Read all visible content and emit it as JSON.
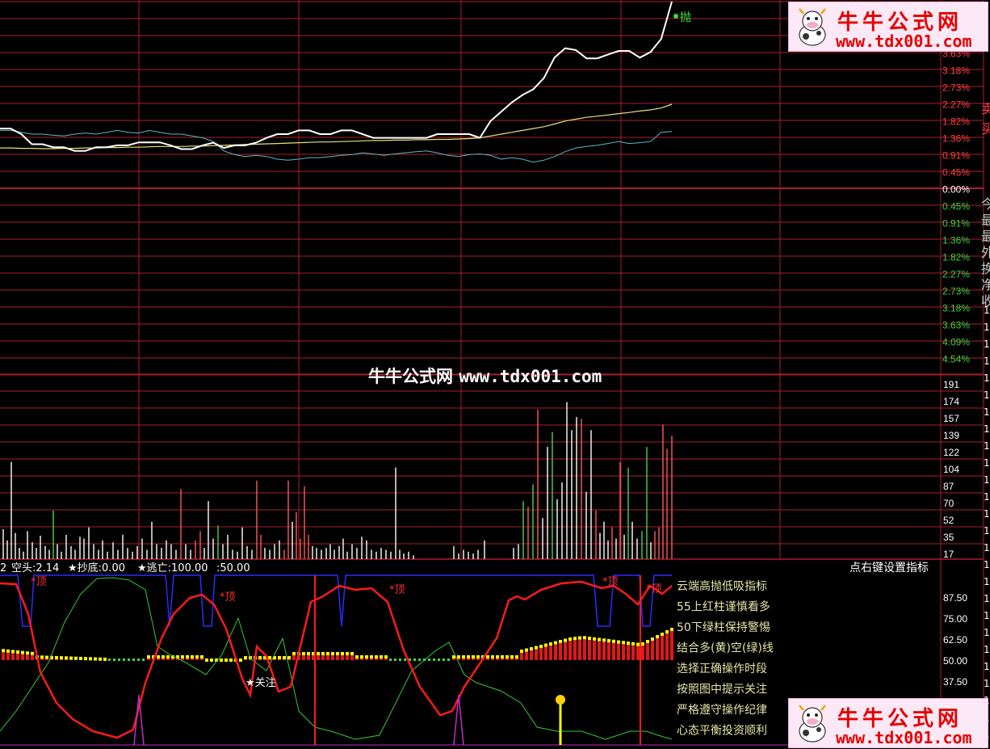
{
  "watermark": {
    "name": "牛牛公式网",
    "url": "www.tdx001.com"
  },
  "logos": [
    {
      "name": "牛牛公式网",
      "url": "www.tdx001.com"
    },
    {
      "name": "牛牛公式网",
      "url": "www.tdx001.com"
    }
  ],
  "colors": {
    "grid": "#a8202a",
    "price": "#ffffff",
    "avg": "#e8e07a",
    "lower_band": "#5fb6c8",
    "up_text": "#ff4040",
    "down_text": "#3cd23c",
    "neutral_text": "#ffffff",
    "blue_line": "#2b2bff",
    "red_line": "#ff1a1a",
    "green_line": "#35c835",
    "yellow": "#ffff00",
    "magenta": "#c02cc0",
    "panel_text": "#e5e5a8"
  },
  "right_edge_chars": [
    "卖",
    "买",
    "今",
    "最",
    "最",
    "外",
    "换",
    "净",
    "收"
  ],
  "chart_data": [
    {
      "type": "line",
      "panel": "intraday price",
      "signal_label": "抛",
      "y_tick_labels": [
        "3.63%",
        "3.18%",
        "2.73%",
        "2.27%",
        "1.82%",
        "1.36%",
        "0.91%",
        "0.45%",
        "0.00%",
        "0.45%",
        "0.91%",
        "1.36%",
        "1.82%",
        "2.27%",
        "2.73%",
        "3.18%",
        "3.63%",
        "4.09%",
        "4.54%"
      ],
      "ylim": [
        -4.54,
        4.54
      ],
      "series": [
        {
          "key": "price",
          "values": [
            1.6,
            1.6,
            1.45,
            1.18,
            1.18,
            1.1,
            1.1,
            1.0,
            1.0,
            1.1,
            1.1,
            1.15,
            1.15,
            1.23,
            1.23,
            1.23,
            1.15,
            1.05,
            1.05,
            1.15,
            1.22,
            1.08,
            1.15,
            1.15,
            1.22,
            1.35,
            1.45,
            1.45,
            1.55,
            1.55,
            1.45,
            1.45,
            1.55,
            1.55,
            1.45,
            1.35,
            1.35,
            1.35,
            1.35,
            1.35,
            1.35,
            1.45,
            1.45,
            1.45,
            1.45,
            1.35,
            1.8,
            2.05,
            2.3,
            2.5,
            2.65,
            2.95,
            3.5,
            3.75,
            3.7,
            3.48,
            3.48,
            3.58,
            3.68,
            3.68,
            3.5,
            3.65,
            4.0,
            5.0
          ]
        },
        {
          "key": "avg",
          "values": [
            1.08,
            1.08,
            1.07,
            1.07,
            1.06,
            1.06,
            1.07,
            1.07,
            1.08,
            1.08,
            1.09,
            1.09,
            1.1,
            1.1,
            1.11,
            1.12,
            1.12,
            1.12,
            1.13,
            1.13,
            1.14,
            1.15,
            1.16,
            1.17,
            1.18,
            1.19,
            1.2,
            1.21,
            1.22,
            1.23,
            1.24,
            1.24,
            1.25,
            1.26,
            1.27,
            1.28,
            1.28,
            1.29,
            1.29,
            1.3,
            1.3,
            1.31,
            1.31,
            1.32,
            1.33,
            1.35,
            1.4,
            1.45,
            1.5,
            1.55,
            1.6,
            1.65,
            1.72,
            1.8,
            1.85,
            1.9,
            1.93,
            1.96,
            2.0,
            2.03,
            2.07,
            2.1,
            2.15,
            2.25
          ]
        },
        {
          "key": "lower",
          "values": [
            1.55,
            1.55,
            1.5,
            1.45,
            1.45,
            1.42,
            1.4,
            1.45,
            1.48,
            1.45,
            1.5,
            1.55,
            1.5,
            1.48,
            1.55,
            1.5,
            1.45,
            1.45,
            1.4,
            1.35,
            1.25,
            1.0,
            0.9,
            0.85,
            0.88,
            0.85,
            0.78,
            0.75,
            0.78,
            0.82,
            0.82,
            0.85,
            0.88,
            0.9,
            0.95,
            0.92,
            0.88,
            0.92,
            0.95,
            0.98,
            1.0,
            0.95,
            0.88,
            0.85,
            0.9,
            0.92,
            0.88,
            0.78,
            0.82,
            0.78,
            0.7,
            0.75,
            0.85,
            0.98,
            1.08,
            1.12,
            1.15,
            1.2,
            1.25,
            1.2,
            1.22,
            1.25,
            1.5,
            1.52
          ]
        }
      ]
    },
    {
      "type": "bar",
      "panel": "volume",
      "y_tick_labels": [
        "191",
        "174",
        "157",
        "139",
        "122",
        "104",
        "87",
        "70",
        "52",
        "35",
        "17"
      ],
      "ylim": [
        0,
        191
      ],
      "bars": [
        [
          4,
          32,
          "w"
        ],
        [
          9,
          20,
          "w"
        ],
        [
          14,
          104,
          "w"
        ],
        [
          19,
          28,
          "w"
        ],
        [
          24,
          12,
          "w"
        ],
        [
          29,
          8,
          "w"
        ],
        [
          34,
          30,
          "w"
        ],
        [
          40,
          18,
          "w"
        ],
        [
          45,
          12,
          "w"
        ],
        [
          50,
          25,
          "w"
        ],
        [
          56,
          14,
          "w"
        ],
        [
          61,
          10,
          "w"
        ],
        [
          66,
          52,
          "g"
        ],
        [
          71,
          16,
          "w"
        ],
        [
          76,
          8,
          "w"
        ],
        [
          82,
          26,
          "w"
        ],
        [
          88,
          14,
          "w"
        ],
        [
          93,
          10,
          "w"
        ],
        [
          99,
          24,
          "w"
        ],
        [
          104,
          22,
          "w"
        ],
        [
          110,
          34,
          "w"
        ],
        [
          116,
          16,
          "w"
        ],
        [
          122,
          10,
          "w"
        ],
        [
          127,
          20,
          "w"
        ],
        [
          133,
          8,
          "w"
        ],
        [
          140,
          18,
          "w"
        ],
        [
          146,
          10,
          "w"
        ],
        [
          152,
          26,
          "w"
        ],
        [
          158,
          12,
          "w"
        ],
        [
          164,
          8,
          "w"
        ],
        [
          170,
          14,
          "w"
        ],
        [
          176,
          22,
          "w"
        ],
        [
          182,
          10,
          "w"
        ],
        [
          188,
          40,
          "w"
        ],
        [
          194,
          16,
          "w"
        ],
        [
          200,
          12,
          "w"
        ],
        [
          206,
          20,
          "w"
        ],
        [
          212,
          16,
          "w"
        ],
        [
          218,
          10,
          "w"
        ],
        [
          224,
          75,
          "r"
        ],
        [
          230,
          16,
          "w"
        ],
        [
          236,
          10,
          "w"
        ],
        [
          242,
          20,
          "r"
        ],
        [
          248,
          30,
          "r"
        ],
        [
          253,
          12,
          "w"
        ],
        [
          258,
          62,
          "w"
        ],
        [
          264,
          22,
          "w"
        ],
        [
          270,
          36,
          "g"
        ],
        [
          276,
          16,
          "w"
        ],
        [
          282,
          26,
          "w"
        ],
        [
          288,
          10,
          "w"
        ],
        [
          294,
          8,
          "w"
        ],
        [
          300,
          34,
          "w"
        ],
        [
          306,
          14,
          "w"
        ],
        [
          312,
          10,
          "w"
        ],
        [
          318,
          84,
          "r"
        ],
        [
          323,
          26,
          "r"
        ],
        [
          328,
          12,
          "w"
        ],
        [
          334,
          10,
          "w"
        ],
        [
          340,
          16,
          "w"
        ],
        [
          346,
          20,
          "w"
        ],
        [
          352,
          10,
          "r"
        ],
        [
          357,
          84,
          "r"
        ],
        [
          362,
          40,
          "w"
        ],
        [
          367,
          50,
          "r"
        ],
        [
          372,
          22,
          "r"
        ],
        [
          377,
          78,
          "r"
        ],
        [
          382,
          26,
          "r"
        ],
        [
          387,
          14,
          "w"
        ],
        [
          392,
          12,
          "w"
        ],
        [
          398,
          10,
          "w"
        ],
        [
          404,
          12,
          "w"
        ],
        [
          409,
          16,
          "w"
        ],
        [
          414,
          10,
          "w"
        ],
        [
          420,
          14,
          "w"
        ],
        [
          425,
          22,
          "w"
        ],
        [
          430,
          8,
          "w"
        ],
        [
          436,
          16,
          "w"
        ],
        [
          442,
          12,
          "w"
        ],
        [
          448,
          24,
          "w"
        ],
        [
          454,
          20,
          "w"
        ],
        [
          460,
          10,
          "w"
        ],
        [
          466,
          8,
          "w"
        ],
        [
          472,
          12,
          "w"
        ],
        [
          478,
          10,
          "w"
        ],
        [
          484,
          8,
          "w"
        ],
        [
          490,
          98,
          "w"
        ],
        [
          495,
          10,
          "w"
        ],
        [
          500,
          6,
          "w"
        ],
        [
          506,
          8,
          "w"
        ],
        [
          512,
          4,
          "w"
        ],
        [
          562,
          14,
          "w"
        ],
        [
          568,
          6,
          "w"
        ],
        [
          574,
          10,
          "w"
        ],
        [
          580,
          8,
          "w"
        ],
        [
          586,
          6,
          "w"
        ],
        [
          592,
          10,
          "w"
        ],
        [
          600,
          20,
          "w"
        ],
        [
          636,
          12,
          "w"
        ],
        [
          642,
          16,
          "w"
        ],
        [
          648,
          62,
          "g"
        ],
        [
          654,
          56,
          "r"
        ],
        [
          660,
          80,
          "g"
        ],
        [
          666,
          160,
          "r"
        ],
        [
          672,
          44,
          "w"
        ],
        [
          678,
          120,
          "w"
        ],
        [
          684,
          136,
          "g"
        ],
        [
          690,
          64,
          "w"
        ],
        [
          696,
          82,
          "w"
        ],
        [
          702,
          168,
          "w"
        ],
        [
          708,
          138,
          "w"
        ],
        [
          714,
          152,
          "w"
        ],
        [
          720,
          150,
          "r"
        ],
        [
          726,
          72,
          "w"
        ],
        [
          732,
          138,
          "w"
        ],
        [
          738,
          52,
          "r"
        ],
        [
          743,
          28,
          "w"
        ],
        [
          748,
          40,
          "w"
        ],
        [
          753,
          20,
          "w"
        ],
        [
          758,
          34,
          "r"
        ],
        [
          763,
          22,
          "w"
        ],
        [
          768,
          104,
          "r"
        ],
        [
          773,
          26,
          "w"
        ],
        [
          778,
          98,
          "g"
        ],
        [
          783,
          40,
          "w"
        ],
        [
          789,
          22,
          "w"
        ],
        [
          795,
          30,
          "g"
        ],
        [
          801,
          120,
          "g"
        ],
        [
          806,
          18,
          "w"
        ],
        [
          811,
          30,
          "r"
        ],
        [
          816,
          34,
          "r"
        ],
        [
          821,
          144,
          "r"
        ],
        [
          826,
          118,
          "r"
        ],
        [
          832,
          132,
          "r"
        ]
      ]
    },
    {
      "type": "line",
      "panel": "indicator",
      "status_bar": {
        "prefix": "2",
        "item1": "空头:2.14",
        "item2": "★抄底:0.00",
        "item3": "★逃亡:100.00",
        "item4": ":50.00"
      },
      "settings_hint": "点右键设置指标",
      "y_tick_labels": [
        "87.50",
        "75.00",
        "62.50",
        "50.00",
        "37.50"
      ],
      "ylim": [
        25,
        100
      ],
      "legend_lines": [
        "云端高抛低吸指标",
        "55上红柱谨慎看多",
        "50下绿柱保持警惕",
        "结合多(黄)空(绿)线",
        "选择正确操作时段",
        "按照图中提示关注",
        "严格遵守操作纪律",
        "心态平衡投资顺利"
      ],
      "annotations": [
        {
          "text": "*顶",
          "x": 38,
          "y": 712
        },
        {
          "text": "*顶",
          "x": 272,
          "y": 731
        },
        {
          "text": "*顶",
          "x": 482,
          "y": 722
        },
        {
          "text": "*顶",
          "x": 746,
          "y": 712
        },
        {
          "text": "*顶",
          "x": 800,
          "y": 721
        },
        {
          "text": "★关注",
          "x": 304,
          "y": 837
        }
      ]
    }
  ]
}
